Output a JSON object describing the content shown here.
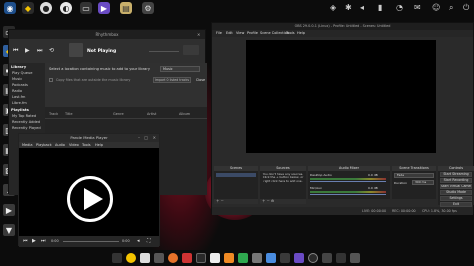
{
  "rhythmbox": {
    "title": "Rhythmbox",
    "now_playing": "Not Playing",
    "import_prompt": "Select a location containing music to add to your library",
    "import_location": "Music",
    "copy_files_label": "Copy files that are outside the music library",
    "import_button": "Import 0 listed tracks",
    "close_button": "Close",
    "sidebar": {
      "library_heading": "Library",
      "library_items": [
        "Play Queue",
        "Music",
        "Podcasts",
        "Radio",
        "Last.fm",
        "Libre.fm"
      ],
      "playlists_heading": "Playlists",
      "playlist_items": [
        "My Top Rated",
        "Recently Added",
        "Recently Played"
      ]
    },
    "columns": [
      "Track",
      "Title",
      "Genre",
      "Artist",
      "Album"
    ]
  },
  "totem": {
    "title": "Parole Media Player",
    "menu": [
      "Media",
      "Playback",
      "Audio",
      "Video",
      "Tools",
      "Help"
    ],
    "time_current": "0:00",
    "time_total": "0:00"
  },
  "obs": {
    "title": "OBS 29.0.0-1 (Linux) - Profile: Untitled - Scenes: Untitled",
    "menu": [
      "File",
      "Edit",
      "View",
      "Profile",
      "Scene Collection",
      "Tools",
      "Help"
    ],
    "docks": {
      "scenes": "Scenes",
      "sources": "Sources",
      "mixer": "Audio Mixer",
      "transitions": "Scene Transitions",
      "controls": "Controls"
    },
    "sources_empty": "You don't have any sources. Click the + button below, or right click here to add one.",
    "mixer_channels": [
      {
        "name": "Desktop Audio",
        "level": "0.0 dB"
      },
      {
        "name": "Mic/Aux",
        "level": "0.0 dB"
      }
    ],
    "transition": "Fade",
    "duration_label": "Duration",
    "duration_value": "300 ms",
    "controls": [
      "Start Streaming",
      "Start Recording",
      "Start Virtual Camera",
      "Studio Mode",
      "Settings",
      "Exit"
    ],
    "status": {
      "live": "LIVE: 00:00:00",
      "rec": "REC: 00:00:00",
      "cpu": "CPU: 1.8%, 30.00 fps"
    }
  },
  "icons": [
    "firefox-icon",
    "python-icon",
    "app-icon",
    "media-icon",
    "archive-icon",
    "settings-icon"
  ],
  "colors": {
    "accent_purple": "#6a4bc4",
    "wall_red": "#c4243c",
    "obs_bg": "#2a2a2a",
    "rhythmbox_bg": "#2b2b2b"
  }
}
